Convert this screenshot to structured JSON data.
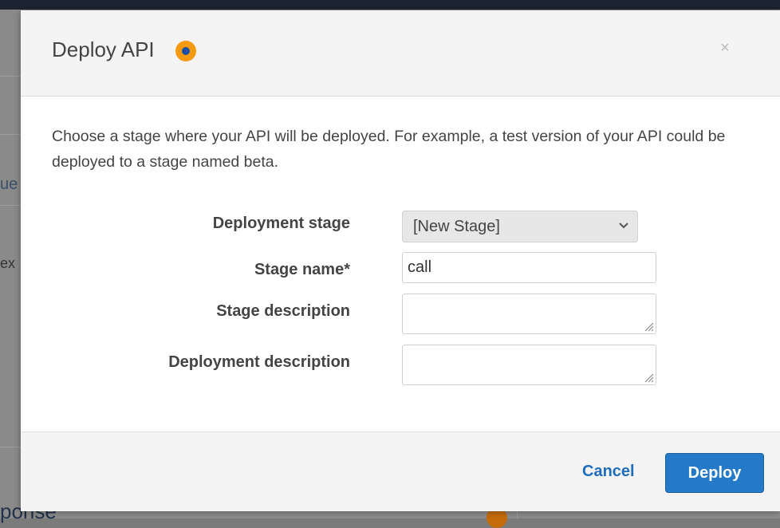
{
  "background": {
    "fragments": [
      "ue",
      "ex",
      "ponse"
    ]
  },
  "modal": {
    "title": "Deploy API",
    "info_icon": "info-dot-icon",
    "close_label": "×",
    "description": "Choose a stage where your API will be deployed. For example, a test version of your API could be deployed to a stage named beta.",
    "fields": {
      "deployment_stage": {
        "label": "Deployment stage",
        "value": "[New Stage]"
      },
      "stage_name": {
        "label": "Stage name*",
        "value": "call"
      },
      "stage_description": {
        "label": "Stage description",
        "value": ""
      },
      "deployment_description": {
        "label": "Deployment description",
        "value": ""
      }
    },
    "footer": {
      "cancel_label": "Cancel",
      "deploy_label": "Deploy"
    }
  },
  "colors": {
    "accent": "#2479c8",
    "info": "#f39a11",
    "link": "#1f6dbb"
  }
}
